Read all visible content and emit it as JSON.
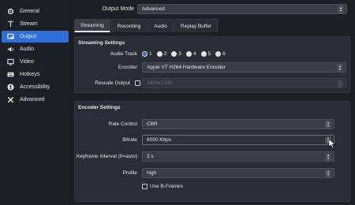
{
  "sidebar": {
    "items": [
      {
        "label": "General",
        "icon": "gear-icon"
      },
      {
        "label": "Stream",
        "icon": "antenna-icon"
      },
      {
        "label": "Output",
        "icon": "monitor-icon"
      },
      {
        "label": "Audio",
        "icon": "speaker-icon"
      },
      {
        "label": "Video",
        "icon": "display-icon"
      },
      {
        "label": "Hotkeys",
        "icon": "keyboard-icon"
      },
      {
        "label": "Accessibility",
        "icon": "accessibility-icon"
      },
      {
        "label": "Advanced",
        "icon": "tools-icon"
      }
    ],
    "active": "Output"
  },
  "output_mode": {
    "label": "Output Mode",
    "value": "Advanced"
  },
  "tabs": [
    {
      "label": "Streaming"
    },
    {
      "label": "Recording"
    },
    {
      "label": "Audio"
    },
    {
      "label": "Replay Buffer"
    }
  ],
  "streaming": {
    "title": "Streaming Settings",
    "audio_track_label": "Audio Track",
    "tracks": [
      "1",
      "2",
      "3",
      "4",
      "5",
      "6"
    ],
    "selected_track": "1",
    "encoder_label": "Encoder",
    "encoder_value": "Apple VT H264 Hardware Encoder",
    "rescale_label": "Rescale Output",
    "rescale_value": "1920x1080"
  },
  "encoder": {
    "title": "Encoder Settings",
    "rate_control_label": "Rate Control",
    "rate_control_value": "CBR",
    "bitrate_label": "Bitrate",
    "bitrate_value": "6000 Kbps",
    "keyframe_label": "Keyframe Interval (0=auto)",
    "keyframe_value": "2 s",
    "profile_label": "Profile",
    "profile_value": "high",
    "bframes_label": "Use B-Frames"
  },
  "colors": {
    "accent": "#2d6fd6",
    "background": "#1d1f26",
    "panel": "#2a2d35"
  }
}
